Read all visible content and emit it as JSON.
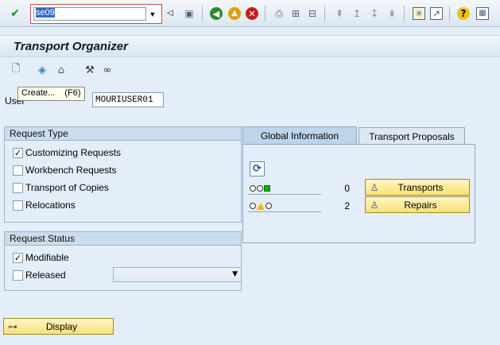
{
  "system_toolbar": {
    "command_field_value": "se09",
    "icons": {
      "enter": "check-icon",
      "save": "save-icon",
      "back": "back-icon",
      "exit": "exit-icon",
      "cancel": "cancel-icon",
      "print": "print-icon",
      "find": "find-icon",
      "find_next": "find-next-icon",
      "first_page": "first-page-icon",
      "prev_page": "previous-page-icon",
      "next_page": "next-page-icon",
      "last_page": "last-page-icon",
      "new_session": "new-session-icon",
      "shortcut": "shortcut-icon",
      "help": "help-icon",
      "layout": "layout-menu-icon"
    }
  },
  "title": "Transport Organizer",
  "app_toolbar": {
    "icons": [
      "create-icon",
      "diamond-tool-icon",
      "organizer-icon",
      "find-requests-icon",
      "glasses-icon"
    ]
  },
  "tooltip": {
    "text": "Create...",
    "shortcut": "(F6)"
  },
  "user": {
    "label": "User",
    "value": "MOURIUSER01"
  },
  "request_type": {
    "title": "Request Type",
    "items": [
      {
        "label": "Customizing Requests",
        "checked": true
      },
      {
        "label": "Workbench Requests",
        "checked": false
      },
      {
        "label": "Transport of Copies",
        "checked": false
      },
      {
        "label": "Relocations",
        "checked": false
      }
    ]
  },
  "request_status": {
    "title": "Request Status",
    "items": [
      {
        "label": "Modifiable",
        "checked": true
      },
      {
        "label": "Released",
        "checked": false
      }
    ],
    "released_select_value": ""
  },
  "tabs": [
    {
      "label": "Global Information",
      "active": true
    },
    {
      "label": "Transport Proposals",
      "active": false
    }
  ],
  "global_info": {
    "rows": [
      {
        "count": "0",
        "button_label": "Transports"
      },
      {
        "count": "2",
        "button_label": "Repairs"
      }
    ]
  },
  "display_button": {
    "label": "Display"
  },
  "colors": {
    "background": "#e4eef8",
    "button_yellow": "#f6e27a",
    "status_green": "#12b012",
    "status_yellow": "#f0c000",
    "command_field_border": "#c85050"
  }
}
